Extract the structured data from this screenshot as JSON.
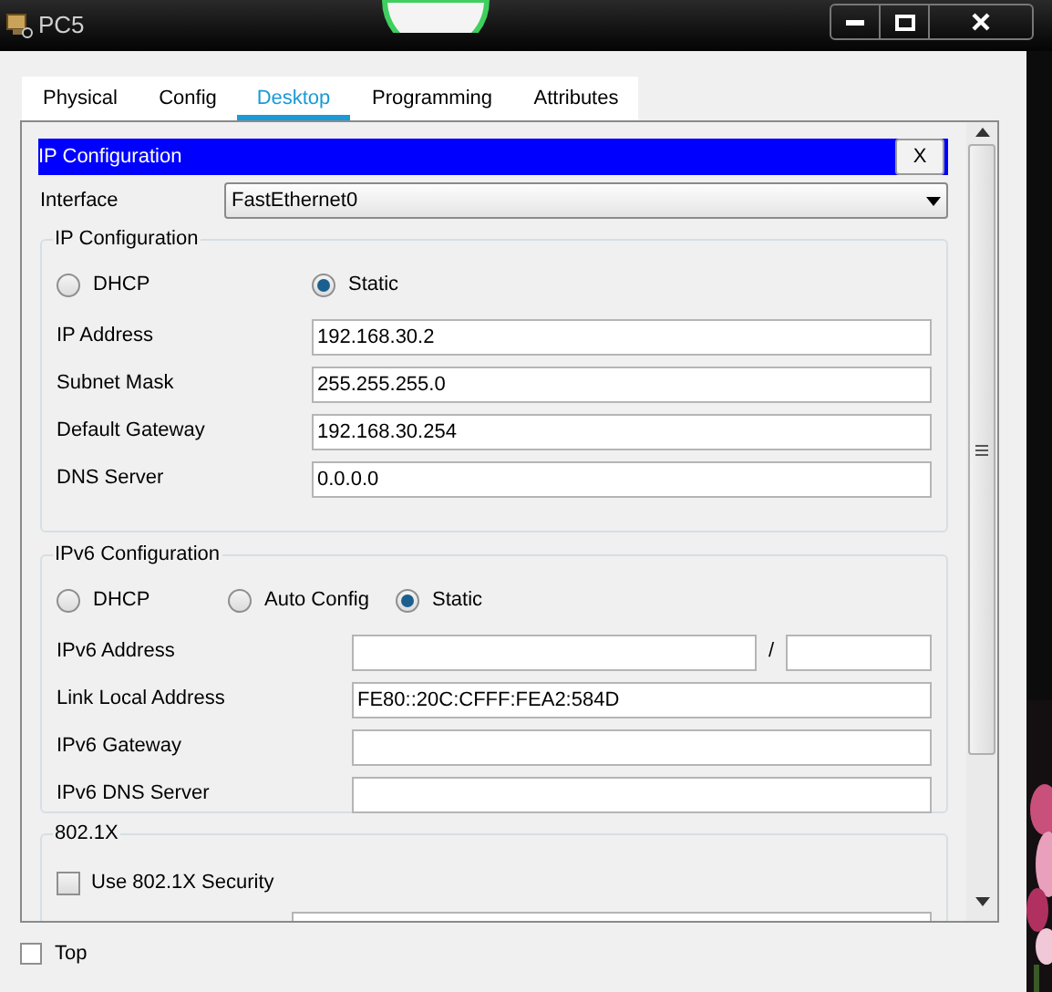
{
  "window": {
    "title": "PC5"
  },
  "tabs": [
    {
      "label": "Physical",
      "selected": false
    },
    {
      "label": "Config",
      "selected": false
    },
    {
      "label": "Desktop",
      "selected": true
    },
    {
      "label": "Programming",
      "selected": false
    },
    {
      "label": "Attributes",
      "selected": false
    }
  ],
  "panel": {
    "title": "IP Configuration",
    "close_label": "X"
  },
  "interface": {
    "label": "Interface",
    "value": "FastEthernet0"
  },
  "ipv4": {
    "title": "IP Configuration",
    "modes": [
      {
        "label": "DHCP",
        "selected": false
      },
      {
        "label": "Static",
        "selected": true
      }
    ],
    "fields": [
      {
        "label": "IP Address",
        "value": "192.168.30.2"
      },
      {
        "label": "Subnet Mask",
        "value": "255.255.255.0"
      },
      {
        "label": "Default Gateway",
        "value": "192.168.30.254"
      },
      {
        "label": "DNS Server",
        "value": "0.0.0.0"
      }
    ]
  },
  "ipv6": {
    "title": "IPv6 Configuration",
    "modes": [
      {
        "label": "DHCP",
        "selected": false
      },
      {
        "label": "Auto Config",
        "selected": false
      },
      {
        "label": "Static",
        "selected": true
      }
    ],
    "fields": [
      {
        "label": "IPv6 Address",
        "separator": "/"
      },
      {
        "label": "Link Local Address",
        "value": "FE80::20C:CFFF:FEA2:584D"
      },
      {
        "label": "IPv6 Gateway"
      },
      {
        "label": "IPv6 DNS Server"
      }
    ]
  },
  "dot1x": {
    "title": "802.1X",
    "options": [
      {
        "label": "Use 802.1X Security",
        "checked": false
      }
    ]
  },
  "top_option": {
    "label": "Top",
    "checked": false
  }
}
